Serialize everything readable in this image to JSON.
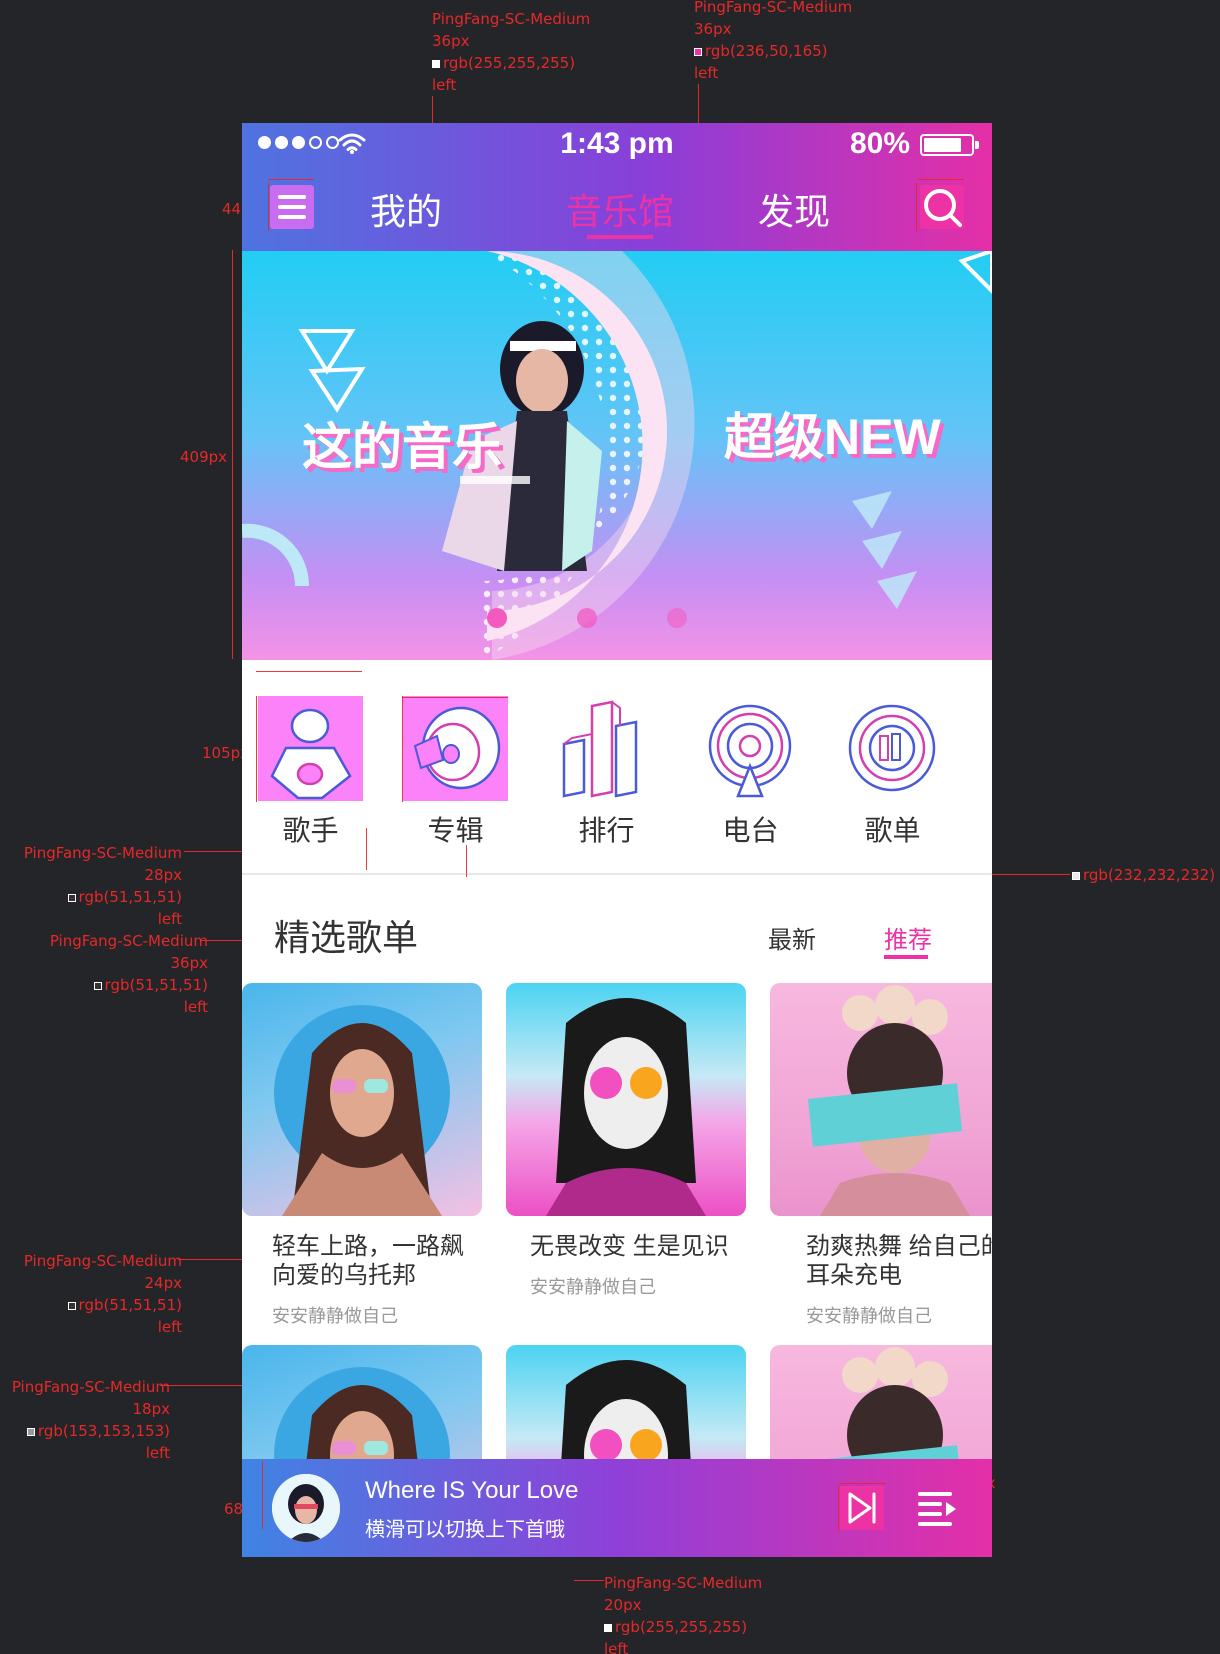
{
  "annotations": {
    "top_left": {
      "font": "PingFang-SC-Medium",
      "size": "36px",
      "color": "rgb(255,255,255)",
      "align": "left"
    },
    "top_right": {
      "font": "PingFang-SC-Medium",
      "size": "36px",
      "color": "rgb(236,50,165)",
      "align": "left"
    },
    "divider": {
      "color": "rgb(232,232,232)"
    },
    "cat_label": {
      "font": "PingFang-SC-Medium",
      "size": "28px",
      "color": "rgb(51,51,51)",
      "align": "left"
    },
    "section": {
      "font": "PingFang-SC-Medium",
      "size": "36px",
      "color": "rgb(51,51,51)",
      "align": "left"
    },
    "card_title": {
      "font": "PingFang-SC-Medium",
      "size": "24px",
      "color": "rgb(51,51,51)",
      "align": "left"
    },
    "player_title": {
      "font": "PingFang-SC-Medium",
      "size": "24px",
      "color": "rgb(255,255,255)",
      "align": "left"
    },
    "card_sub": {
      "font": "PingFang-SC-Medium",
      "size": "18px",
      "color": "rgb(153,153,153)",
      "align": "left"
    },
    "player_sub": {
      "font": "PingFang-SC-Medium",
      "size": "20px",
      "color": "rgb(255,255,255)",
      "align": "left"
    },
    "measures": {
      "m44a": "44px",
      "m44b": "44px",
      "m44c": "44px",
      "m44d": "44px",
      "m66": "66px",
      "m4": "4px",
      "m409": "409px",
      "m105a": "105px",
      "m42": "42px",
      "m105b": "105px",
      "m105c": "105px",
      "m105d": "105px",
      "m40a": "40px",
      "m8a": "8px",
      "m32a": "32px",
      "m32b": "32px",
      "m42b": "42px",
      "m32c": "32px",
      "m72": "72px",
      "m8b": "8px",
      "m16a": "16px",
      "m240": "240px",
      "m233": "233px",
      "m24": "24px",
      "m16b": "16px",
      "m40b": "40px",
      "m12": "12px",
      "m32d": "32px",
      "m68": "68px",
      "m20": "20px",
      "m16c": "16px",
      "m44e": "44px",
      "m44f": "44px",
      "m32e": "32px",
      "m32f": "32px"
    }
  },
  "status_bar": {
    "time": "1:43 pm",
    "battery": "80%",
    "battery_level": 0.8,
    "signal_dots": 5,
    "signal_filled": 3
  },
  "nav": {
    "menu_icon": "menu-icon",
    "tabs": [
      {
        "label": "我的",
        "active": false
      },
      {
        "label": "音乐馆",
        "active": true
      },
      {
        "label": "发现",
        "active": false
      }
    ],
    "search_icon": "search-icon"
  },
  "banner": {
    "left_text": "这的音乐",
    "right_text": "超级NEW",
    "pages": 3,
    "current_page": 1
  },
  "categories": [
    {
      "label": "歌手",
      "icon": "singer-icon"
    },
    {
      "label": "专辑",
      "icon": "album-icon"
    },
    {
      "label": "排行",
      "icon": "ranking-icon"
    },
    {
      "label": "电台",
      "icon": "radio-icon"
    },
    {
      "label": "歌单",
      "icon": "playlist-icon"
    }
  ],
  "section": {
    "title": "精选歌单",
    "filters": [
      {
        "label": "最新",
        "active": false
      },
      {
        "label": "推荐",
        "active": true
      }
    ]
  },
  "playlists": [
    {
      "title": "轻车上路，一路飙向爱的乌托邦",
      "sub": "安安静静做自己"
    },
    {
      "title": "无畏改变 生是见识",
      "sub": "安安静静做自己"
    },
    {
      "title": "劲爽热舞 给自己的耳朵充电",
      "sub": "安安静静做自己"
    }
  ],
  "player": {
    "title": "Where IS Your Love",
    "sub": "横滑可以切换上下首哦",
    "next_icon": "next-track-icon",
    "list_icon": "playlist-queue-icon"
  },
  "colors": {
    "accent": "#ec32a5",
    "gradient_start": "#4f73e0",
    "gradient_end": "#e42fa7",
    "text": "#333333",
    "sub_text": "#999999",
    "divider": "#e8e8e8"
  }
}
